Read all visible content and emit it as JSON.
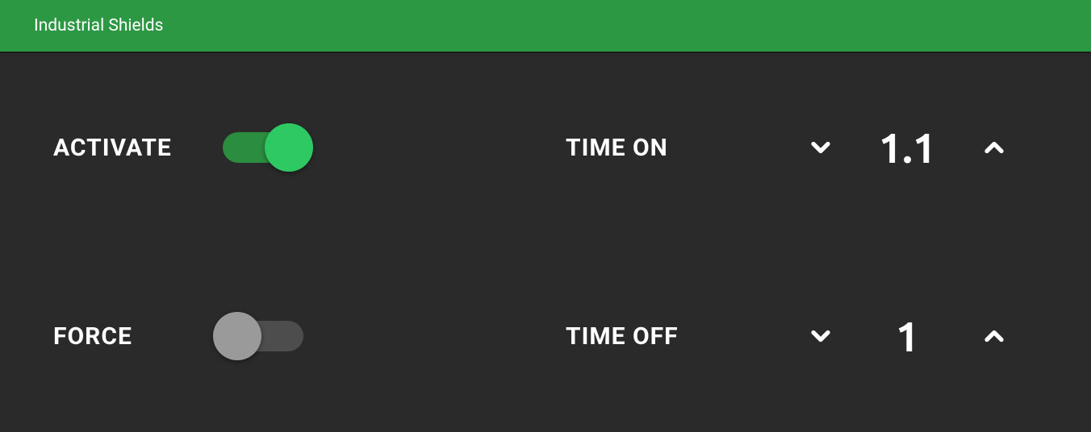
{
  "header": {
    "title": "Industrial Shields"
  },
  "controls": {
    "activate": {
      "label": "ACTIVATE",
      "state": "on"
    },
    "force": {
      "label": "FORCE",
      "state": "off"
    },
    "time_on": {
      "label": "TIME ON",
      "value": "1.1"
    },
    "time_off": {
      "label": "TIME OFF",
      "value": "1"
    }
  },
  "colors": {
    "header_bg": "#2c9844",
    "body_bg": "#2a2a2a",
    "toggle_on_track": "#2a8d3f",
    "toggle_on_knob": "#2fc963",
    "toggle_off_track": "#4d4d4d",
    "toggle_off_knob": "#9a9a9a",
    "text": "#ffffff"
  }
}
